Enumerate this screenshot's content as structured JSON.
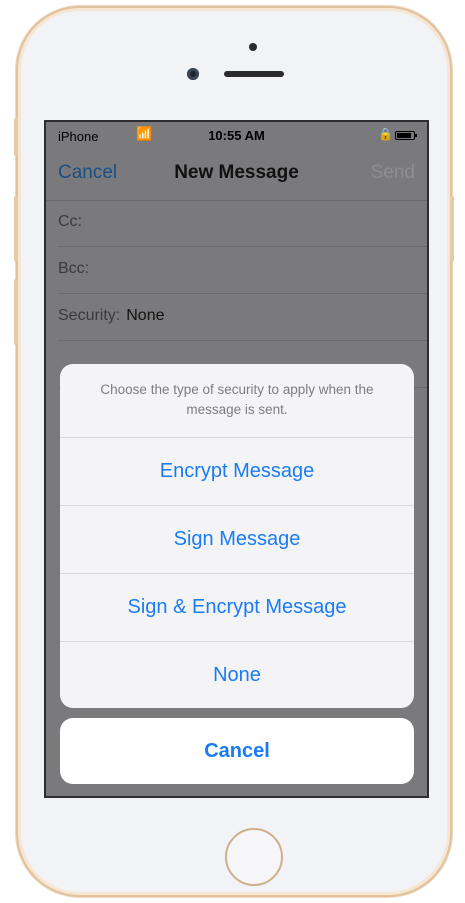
{
  "status_bar": {
    "carrier": "iPhone",
    "wifi_icon": "wifi-icon",
    "time": "10:55 AM",
    "lock_icon": "rotation-lock-icon",
    "battery_icon": "battery-icon"
  },
  "nav": {
    "cancel": "Cancel",
    "title": "New Message",
    "send": "Send"
  },
  "fields": {
    "cc_label": "Cc:",
    "bcc_label": "Bcc:",
    "security_label": "Security:",
    "security_value": "None"
  },
  "action_sheet": {
    "message": "Choose the type of security to apply when the message is sent.",
    "options": [
      "Encrypt Message",
      "Sign Message",
      "Sign & Encrypt Message",
      "None"
    ],
    "cancel": "Cancel"
  },
  "colors": {
    "accent": "#1a7cf5",
    "frame": "#e0c29e",
    "dim_overlay": "#7a7a7c"
  }
}
